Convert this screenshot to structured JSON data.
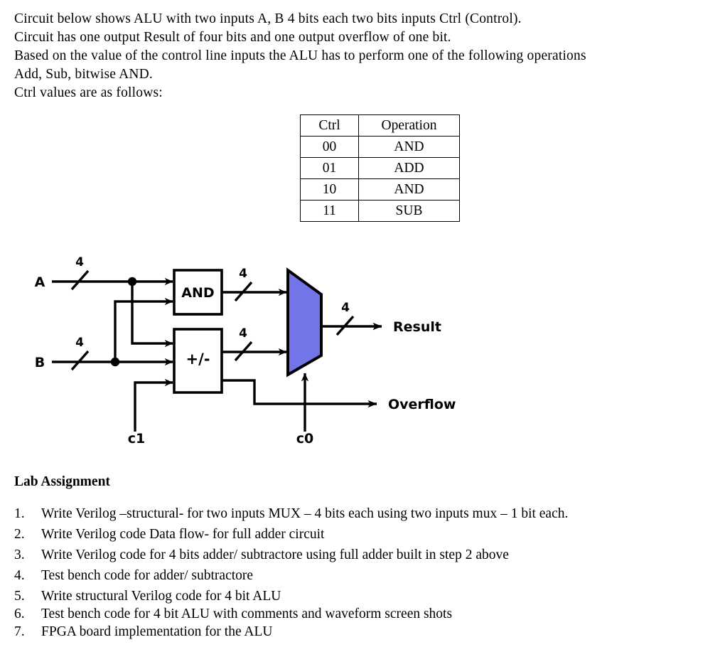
{
  "intro": {
    "lines": [
      "Circuit below shows ALU with two inputs A, B 4 bits each two bits inputs Ctrl (Control).",
      "Circuit has one output Result of four bits and one output overflow of one bit.",
      "Based on the value of the control line inputs the ALU has to perform one of the following operations",
      "Add, Sub, bitwise AND.",
      "Ctrl values are as follows:"
    ]
  },
  "ctrl_table": {
    "headers": [
      "Ctrl",
      "Operation"
    ],
    "rows": [
      {
        "ctrl": "00",
        "operation": "AND"
      },
      {
        "ctrl": "01",
        "operation": "ADD"
      },
      {
        "ctrl": "10",
        "operation": "AND"
      },
      {
        "ctrl": "11",
        "operation": "SUB"
      }
    ]
  },
  "diagram": {
    "inputs": {
      "a": "A",
      "b": "B",
      "c1": "c1",
      "c0": "c0"
    },
    "blocks": {
      "and": "AND",
      "addsub": "+/-"
    },
    "outputs": {
      "result": "Result",
      "overflow": "Overflow"
    },
    "bus_widths": {
      "a_in": "4",
      "b_in": "4",
      "and_out": "4",
      "addsub_out": "4",
      "result_out": "4"
    },
    "colors": {
      "mux_fill": "#7274E8",
      "wire": "#000000",
      "block_fill": "#FFFFFF"
    }
  },
  "lab": {
    "heading": "Lab Assignment",
    "tasks": [
      {
        "num": "1.",
        "text": "Write Verilog –structural- for two inputs MUX – 4 bits each using two inputs mux – 1 bit each."
      },
      {
        "num": "2.",
        "text": "Write Verilog code Data flow- for full adder circuit"
      },
      {
        "num": "3.",
        "text": "Write Verilog code for 4 bits adder/ subtractore  using full adder  built in step 2 above"
      },
      {
        "num": "4.",
        "text": "Test bench code for adder/ subtractore"
      },
      {
        "num": "5.",
        "text": "Write structural Verilog code for 4 bit ALU"
      },
      {
        "num": "6.",
        "text": "Test bench code for 4 bit ALU with comments and waveform screen shots"
      },
      {
        "num": "7.",
        "text": "FPGA board implementation for the ALU"
      }
    ]
  }
}
